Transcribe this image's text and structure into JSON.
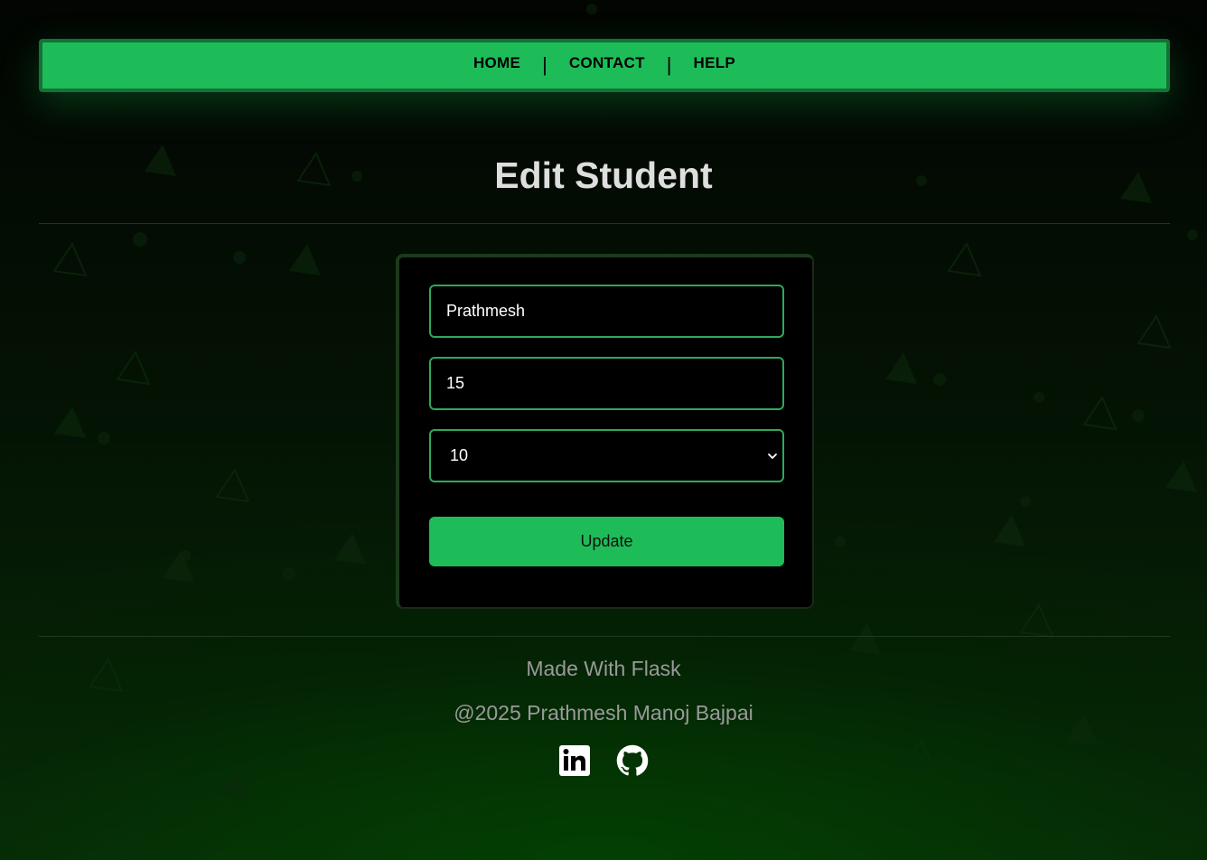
{
  "nav": {
    "items": [
      {
        "label": "HOME"
      },
      {
        "label": "CONTACT"
      },
      {
        "label": "HELP"
      }
    ],
    "separator": "|"
  },
  "page": {
    "title": "Edit Student"
  },
  "form": {
    "name_value": "Prathmesh",
    "age_value": "15",
    "class_selected": "10",
    "submit_label": "Update"
  },
  "footer": {
    "made_with": "Made With Flask",
    "copyright": "@2025 Prathmesh Manoj Bajpai",
    "social": [
      {
        "icon": "linkedin-icon"
      },
      {
        "icon": "github-icon"
      }
    ]
  },
  "colors": {
    "accent": "#1ebc58",
    "accent_dark": "#127336",
    "field_border": "#2fa85b",
    "background": "#041204"
  }
}
